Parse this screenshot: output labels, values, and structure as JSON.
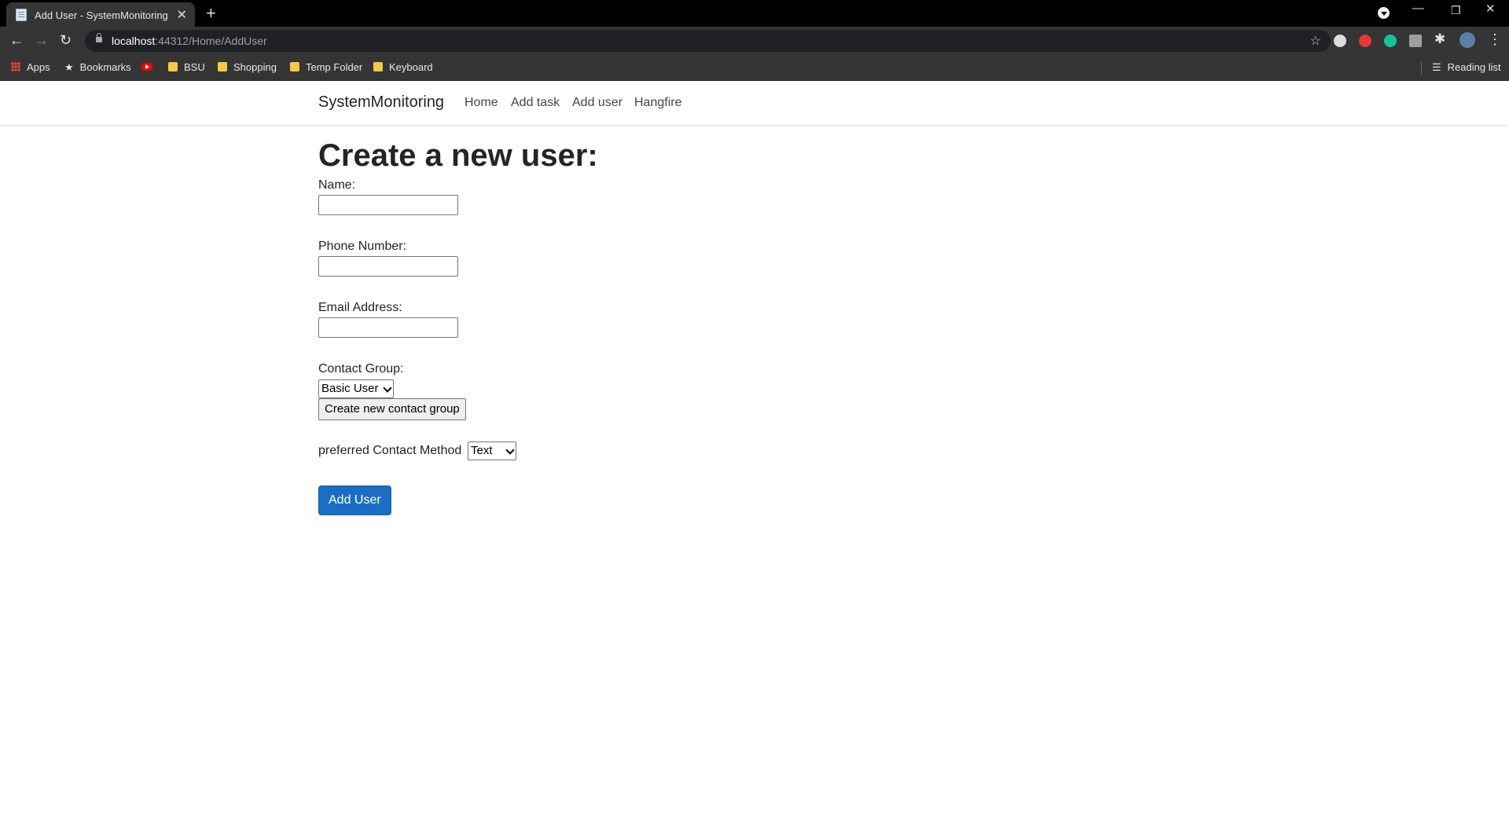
{
  "browser": {
    "tab_title": "Add User - SystemMonitoring",
    "tab_close": "✕",
    "new_tab": "+",
    "url_host": "localhost",
    "url_path": ":44312/Home/AddUser",
    "bookmarks": [
      "Apps",
      "Bookmarks",
      "BSU",
      "Shopping",
      "Temp Folder",
      "Keyboard"
    ],
    "reading_list": "Reading list",
    "window_controls": {
      "minimize": "—",
      "restore": "❐",
      "close": "✕"
    },
    "extension_colors": [
      "#dddddd",
      "#e53935",
      "#15c39a",
      "#9e9e9e"
    ]
  },
  "site": {
    "brand": "SystemMonitoring",
    "nav": [
      "Home",
      "Add task",
      "Add user",
      "Hangfire"
    ]
  },
  "form": {
    "heading": "Create a new user:",
    "name_label": "Name:",
    "name_value": "",
    "phone_label": "Phone Number:",
    "phone_value": "",
    "email_label": "Email Address:",
    "email_value": "",
    "contact_group_label": "Contact Group:",
    "contact_group_selected": "Basic User",
    "create_group_button": "Create new contact group",
    "contact_method_label": "preferred Contact Method",
    "contact_method_selected": "Text",
    "submit_button": "Add User"
  },
  "colors": {
    "primary": "#1b6ec2",
    "chrome_dark": "#353535"
  }
}
